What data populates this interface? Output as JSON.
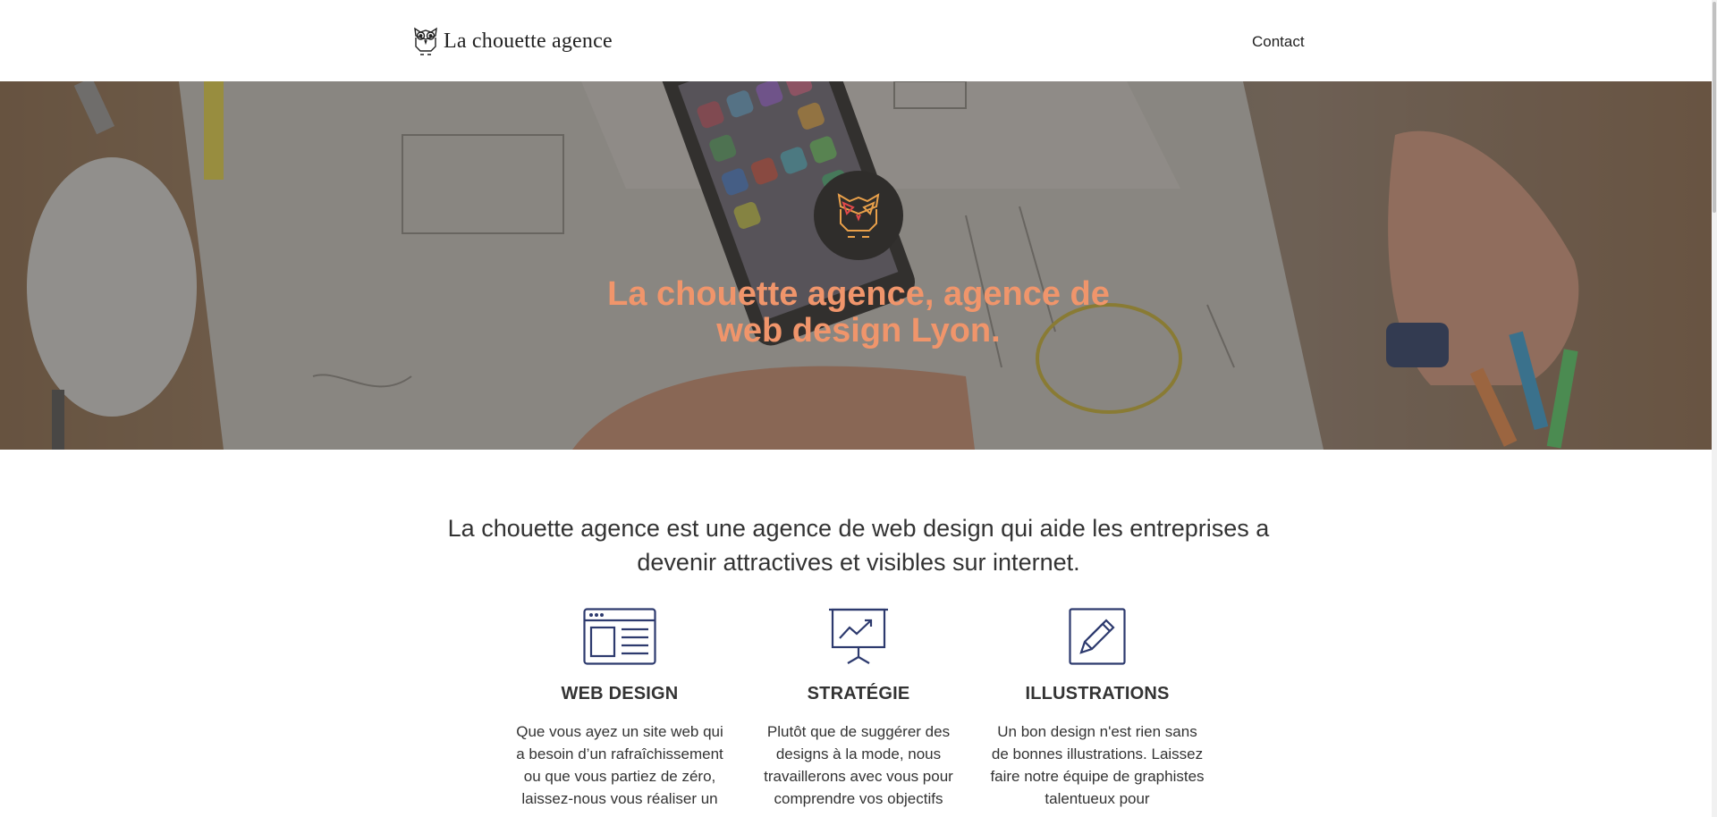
{
  "header": {
    "brand_name": "La chouette agence",
    "nav": {
      "contact_label": "Contact"
    }
  },
  "hero": {
    "title": "La chouette agence, agence de web design Lyon.",
    "badge_icon": "owl-logo-icon",
    "title_color": "#f0956b"
  },
  "intro": {
    "text": "La chouette agence est une agence de web design qui aide les entreprises a devenir attractives et visibles sur internet."
  },
  "services": [
    {
      "icon": "browser-window-icon",
      "title": "WEB DESIGN",
      "text": "Que vous ayez un site web qui a besoin d’un rafraîchissement ou que vous partiez de zéro, laissez-nous vous réaliser un"
    },
    {
      "icon": "presentation-chart-icon",
      "title": "STRATÉGIE",
      "text": "Plutôt que de suggérer des designs à la mode, nous travaillerons avec vous pour comprendre vos objectifs"
    },
    {
      "icon": "pencil-icon",
      "title": "ILLUSTRATIONS",
      "text": "Un bon design n'est rien sans de bonnes illustrations. Laissez faire notre équipe de graphistes talentueux pour"
    }
  ],
  "colors": {
    "icon_stroke": "#2d3a6e",
    "text": "#333333"
  }
}
